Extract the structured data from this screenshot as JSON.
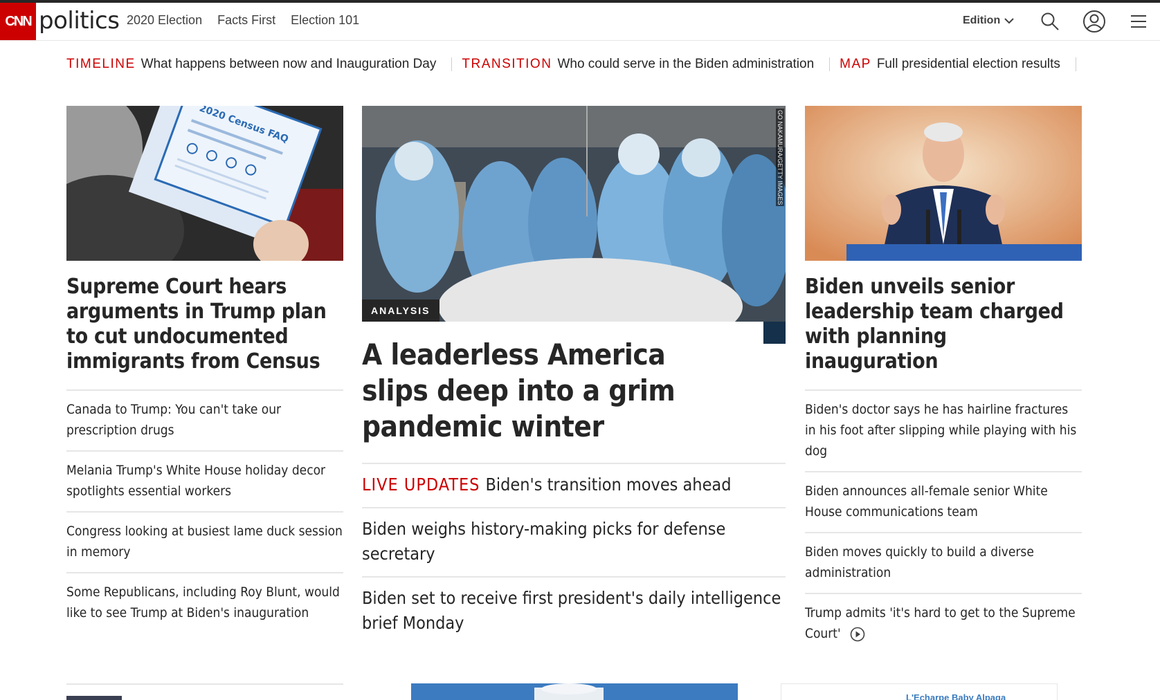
{
  "header": {
    "logo": "CNN",
    "section": "politics",
    "nav": [
      "2020 Election",
      "Facts First",
      "Election 101"
    ],
    "edition_label": "Edition"
  },
  "trending": [
    {
      "label": "TIMELINE",
      "text": "What happens between now and Inauguration Day"
    },
    {
      "label": "TRANSITION",
      "text": "Who could serve in the Biden administration"
    },
    {
      "label": "MAP",
      "text": "Full presidential election results"
    }
  ],
  "left": {
    "headline": "Supreme Court hears arguments in Trump plan to cut undocumented immigrants from Census",
    "image_text": "2020 Census FAQ",
    "items": [
      "Canada to Trump: You can't take our prescription drugs",
      "Melania Trump's White House holiday decor spotlights essential workers",
      "Congress looking at busiest lame duck session in memory",
      "Some Republicans, including Roy Blunt, would like to see Trump at Biden's inauguration"
    ]
  },
  "middle": {
    "badge": "ANALYSIS",
    "credit": "GO NAKAMURA/GETTY IMAGES",
    "headline": "A leaderless America slips deep into a grim pandemic winter",
    "live_label": "LIVE UPDATES",
    "live_text": "Biden's transition moves ahead",
    "items": [
      "Biden weighs history-making picks for defense secretary",
      "Biden set to receive first president's daily intelligence brief Monday"
    ]
  },
  "right": {
    "headline": "Biden unveils senior leadership team charged with planning inauguration",
    "items": [
      "Biden's doctor says he has hairline fractures in his foot after slipping while playing with his dog",
      "Biden announces all-female senior White House communications team",
      "Biden moves quickly to build a diverse administration",
      "Trump admits 'it's hard to get to the Supreme Court'"
    ]
  },
  "bottom": {
    "right_text": "L'Echarpe Baby Alpaga"
  },
  "colors": {
    "cnn_red": "#cc0000",
    "text": "#262626",
    "divider": "#e6e6e6"
  }
}
